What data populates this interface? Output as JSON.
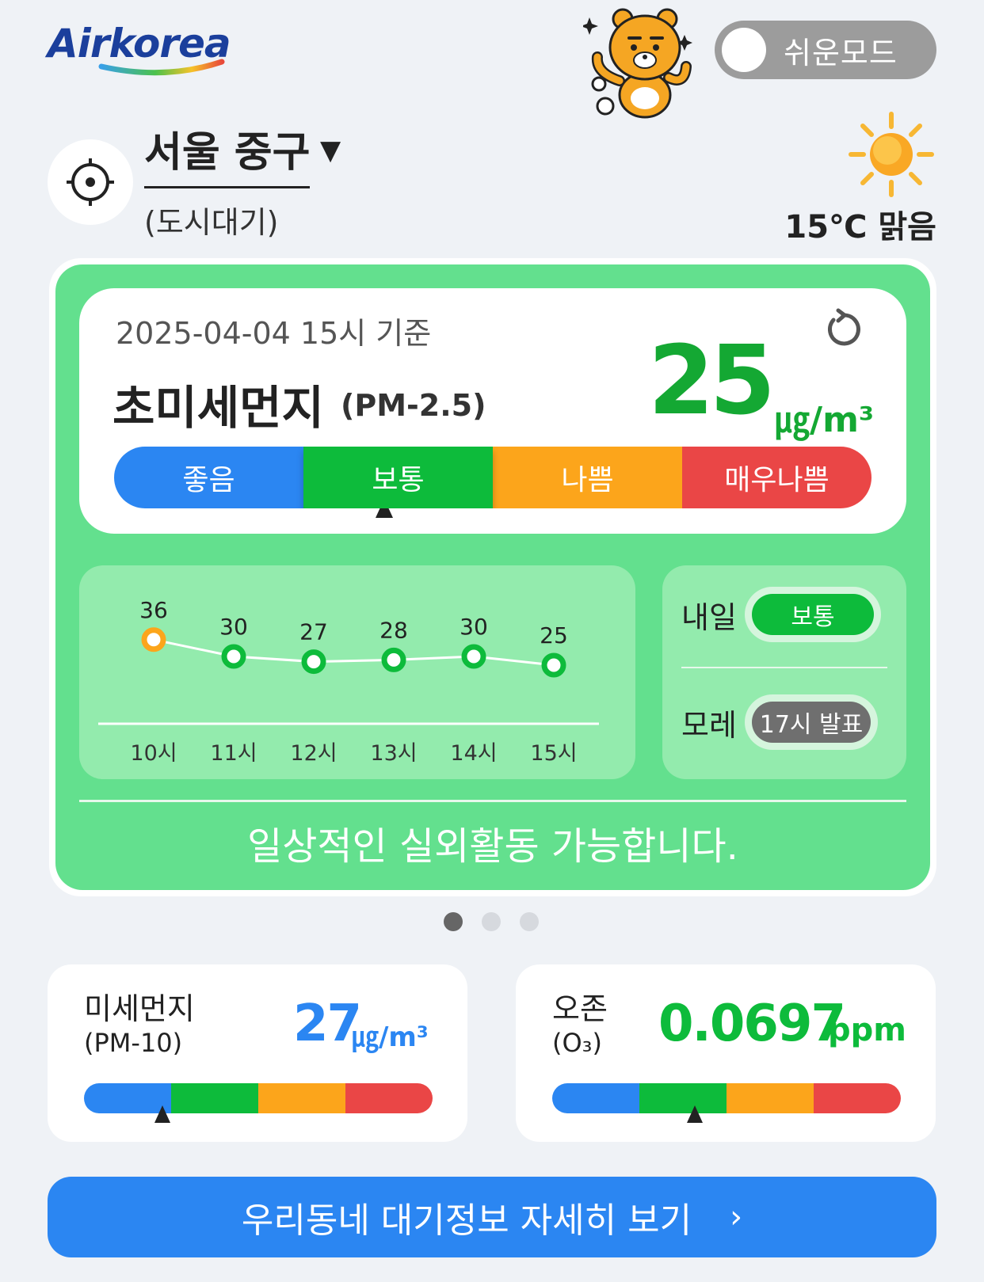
{
  "header": {
    "logo_text": "Airkorea",
    "easy_mode_label": "쉬운모드",
    "location_name": "서울 중구",
    "location_type": "(도시대기)",
    "weather_text": "15℃ 맑음"
  },
  "pm25": {
    "timestamp": "2025-04-04 15시 기준",
    "title": "초미세먼지",
    "subtitle": "(PM-2.5)",
    "value": "25",
    "unit": "㎍/m³",
    "grades": [
      "좋음",
      "보통",
      "나쁨",
      "매우나쁨"
    ],
    "current_grade": "보통",
    "message": "일상적인 실외활동 가능합니다."
  },
  "trend": {
    "hours": [
      "10시",
      "11시",
      "12시",
      "13시",
      "14시",
      "15시"
    ],
    "values": [
      36,
      30,
      27,
      28,
      30,
      25
    ],
    "colors": [
      "#fca51b",
      "#0dbb3b",
      "#0dbb3b",
      "#0dbb3b",
      "#0dbb3b",
      "#0dbb3b"
    ]
  },
  "forecast": {
    "tomorrow_label": "내일",
    "tomorrow_grade": "보통",
    "dust_label": "모레",
    "dust_status": "17시 발표"
  },
  "pager": {
    "pages": 3,
    "active": 1
  },
  "pm10": {
    "title": "미세먼지",
    "subtitle": "(PM-10)",
    "value": "27",
    "unit": "㎍/m³",
    "color": "#2b86f2",
    "level": 0.225
  },
  "ozone": {
    "title": "오존",
    "subtitle": "(O₃)",
    "value": "0.0697",
    "unit": "ppm",
    "color": "#0dbb3b",
    "level": 0.41
  },
  "detail_button": {
    "label": "우리동네 대기정보 자세히 보기",
    "chevron": "›"
  },
  "colors": {
    "good": "#2b86f2",
    "normal": "#0dbb3b",
    "bad": "#fca51b",
    "very_bad": "#ea4646",
    "card_bg": "#63e08e"
  }
}
